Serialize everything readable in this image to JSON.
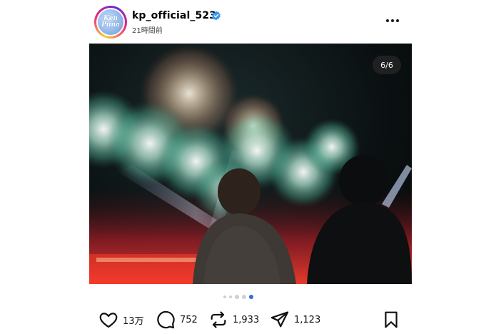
{
  "post": {
    "username": "kp_official_523",
    "timestamp": "21時間前",
    "avatar_text": "Ken Puna"
  },
  "media": {
    "counter": "6/6",
    "total_slides": 6,
    "current_slide": 6
  },
  "actions": {
    "likes": "13万",
    "comments": "752",
    "reposts": "1,933",
    "shares": "1,123"
  },
  "icons": {
    "verified": "verified-badge-icon",
    "more": "more-options-icon",
    "like": "heart-icon",
    "comment": "comment-icon",
    "repost": "repost-icon",
    "share": "send-icon",
    "save": "bookmark-icon"
  },
  "colors": {
    "verified": "#3897f0",
    "active_dot": "#2e6be6",
    "inactive_dot": "#d0d0d0"
  }
}
